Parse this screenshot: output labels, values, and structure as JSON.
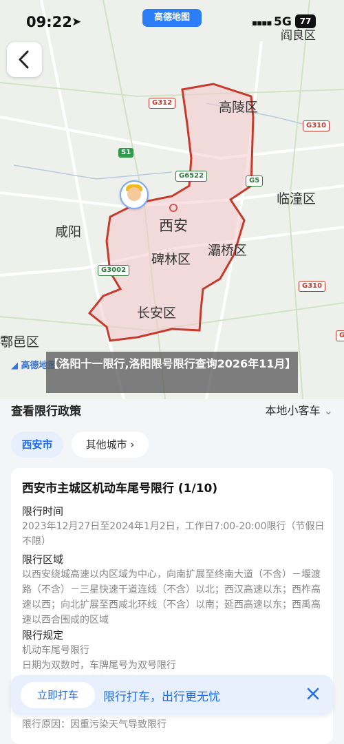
{
  "status_bar": {
    "time": "09:22",
    "location_arrow": "➤",
    "app_badge": "高德地图",
    "signal": "▪▪▪▪",
    "network": "5G",
    "battery": "77"
  },
  "map": {
    "roads": [
      "G312",
      "G310",
      "S1",
      "G6522",
      "G5",
      "G3002"
    ],
    "districts": {
      "gaoling": "高陵区",
      "lintong": "临潼区",
      "xianyang": "咸阳",
      "xian": "西安",
      "beilin": "碑林区",
      "baqiao": "灞桥区",
      "changan": "长安区",
      "huyi": "鄠邑区",
      "yanliang": "阎良区"
    },
    "logo": "高德地图"
  },
  "caption": "【洛阳十一限行,洛阳限号限行查询2026年11月】",
  "panel": {
    "title": "查看限行政策",
    "vehicle_type": "本地小客车"
  },
  "chips": {
    "active": "西安市",
    "other": "其他城市"
  },
  "card": {
    "title": "西安市主城区机动车尾号限行 (1/10)",
    "time_label": "限行时间",
    "time_text": "2023年12月27日至2024年1月2日，工作日7:00-20:00限行（节假日不限）",
    "area_label": "限行区域",
    "area_text": "以西安绕城高速以内区域为中心，向南扩展至终南大道（不含）－堰渡路（不含）－三星快速干道连线（不含）以北；西汉高速以东；西柞高速以西；向北扩展至西咸北环线（不含）以南；延西高速以东；西禹高速以西合围成的区域",
    "rule_label": "限行规定",
    "rule_text": "机动车尾号限行\n日期为双数时，车牌尾号为双号限行\n日期为单数时，车牌尾号为单号限行",
    "reason_text": "限行原因：因重污染天气导致限行"
  },
  "bottom_bar": {
    "button": "立即打车",
    "text": "限行打车，出行更无忧"
  }
}
